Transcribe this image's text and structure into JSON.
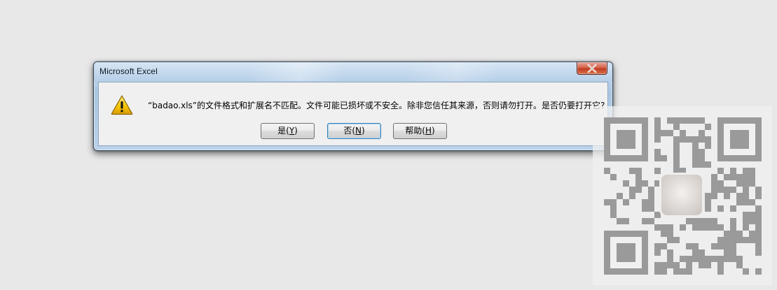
{
  "dialog": {
    "title": "Microsoft Excel",
    "message": "“badao.xls”的文件格式和扩展名不匹配。文件可能已损坏或不安全。除非您信任其来源，否则请勿打开。是否仍要打开它?",
    "icon": "warning-icon",
    "buttons": {
      "yes": {
        "label": "是",
        "mnemonic_open": "(",
        "mnemonic": "Y",
        "mnemonic_close": ")"
      },
      "no": {
        "label": "否",
        "mnemonic_open": "(",
        "mnemonic": "N",
        "mnemonic_close": ")",
        "default": true
      },
      "help": {
        "label": "帮助",
        "mnemonic_open": "(",
        "mnemonic": "H",
        "mnemonic_close": ")"
      }
    },
    "close_icon": "close-icon"
  },
  "watermark": {
    "type": "qr-code",
    "icon": "qr-code-icon"
  },
  "colors": {
    "desktop": "#e8e8e8",
    "title_bar": "#b6cfe8",
    "close_button": "#c23d20",
    "dialog_body": "#f0f0f0",
    "default_button_border": "#3c7fb1",
    "warning_yellow": "#f5c400"
  }
}
